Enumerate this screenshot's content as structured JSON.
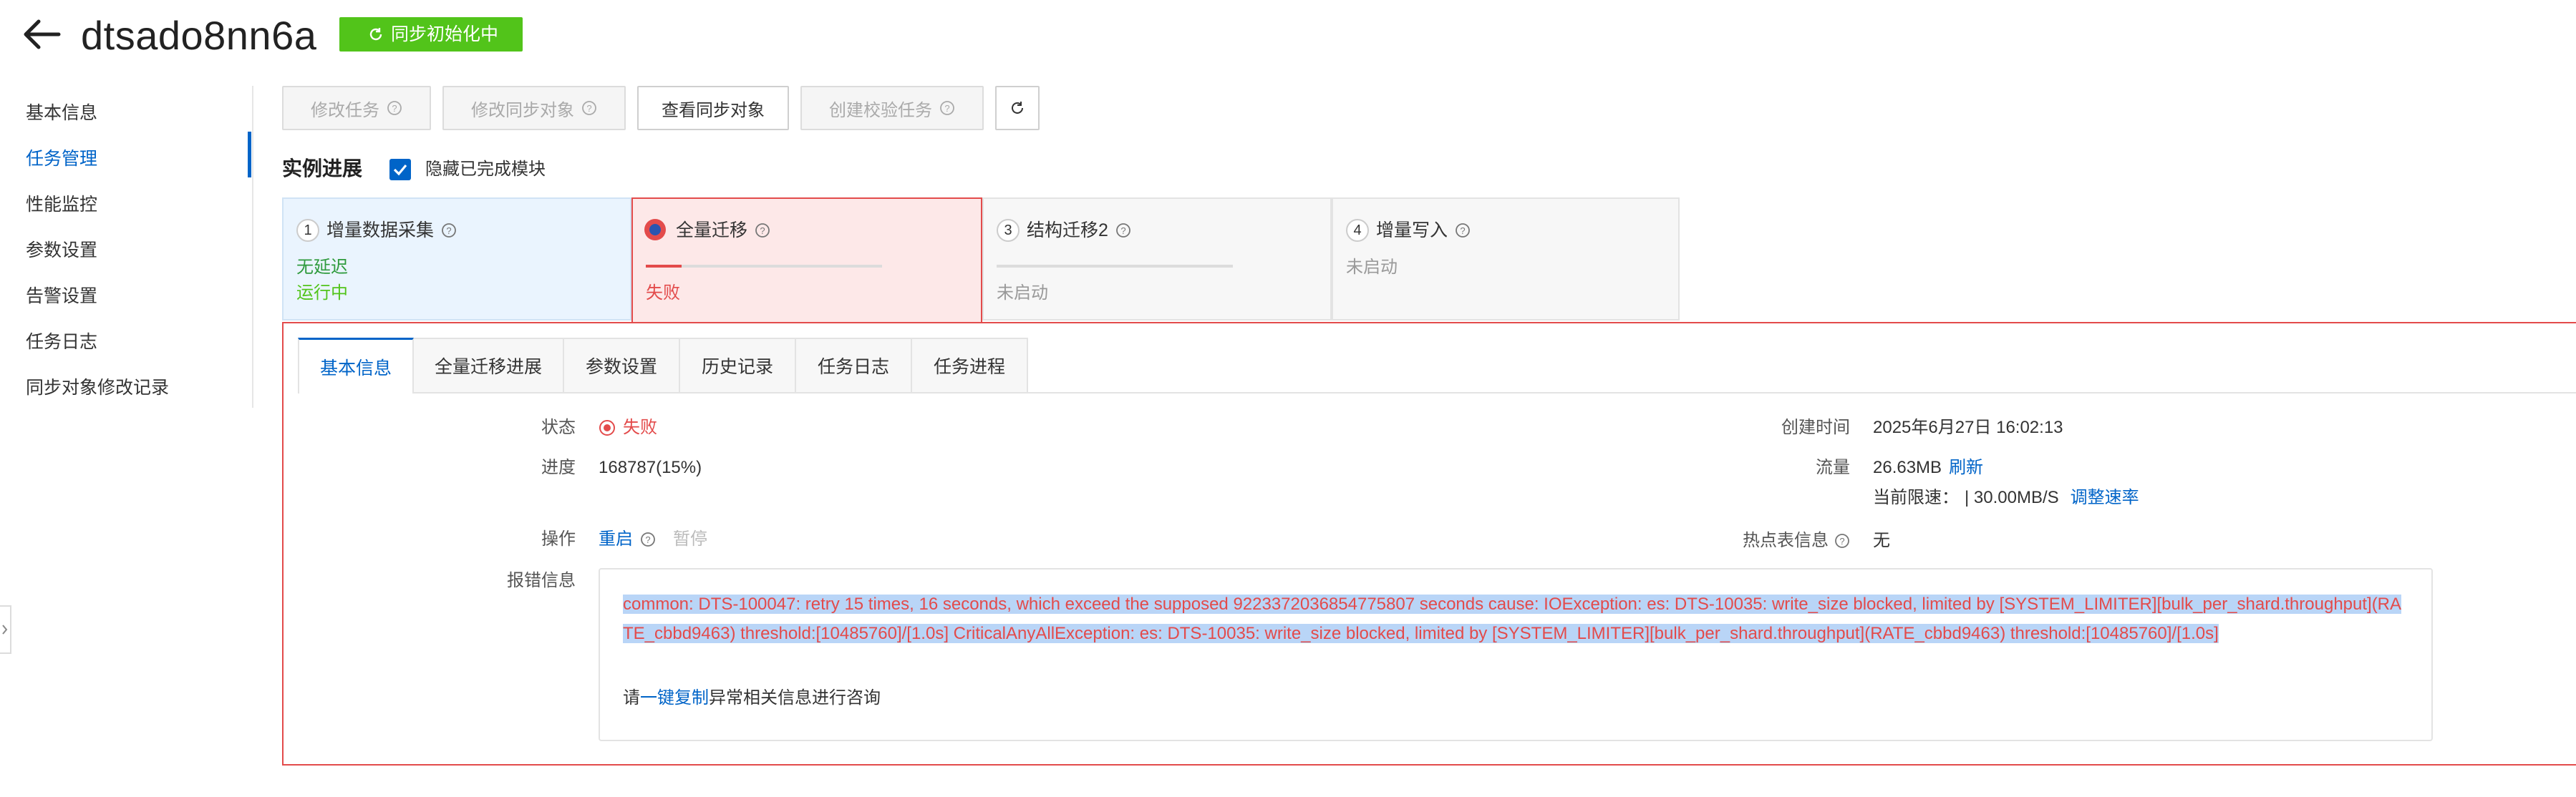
{
  "header": {
    "title": "dtsado8nn6a",
    "status_tag": "同步初始化中"
  },
  "sidebar": {
    "items": [
      {
        "label": "基本信息"
      },
      {
        "label": "任务管理"
      },
      {
        "label": "性能监控"
      },
      {
        "label": "参数设置"
      },
      {
        "label": "告警设置"
      },
      {
        "label": "任务日志"
      },
      {
        "label": "同步对象修改记录"
      }
    ],
    "active_index": 1
  },
  "toolbar": {
    "modify_task": "修改任务",
    "modify_sync_objects": "修改同步对象",
    "view_sync_objects": "查看同步对象",
    "create_check_task": "创建校验任务"
  },
  "progress": {
    "title": "实例进展",
    "hide_completed_label": "隐藏已完成模块",
    "hide_completed_checked": true,
    "steps": [
      {
        "num": "1",
        "name": "增量数据采集",
        "line1": "无延迟",
        "line2": "运行中"
      },
      {
        "num": "",
        "name": "全量迁移",
        "line1": "失败",
        "progress": 0.15
      },
      {
        "num": "3",
        "name": "结构迁移2",
        "line1": "未启动",
        "progress": 0
      },
      {
        "num": "4",
        "name": "增量写入",
        "line1": "未启动"
      }
    ]
  },
  "tabs": [
    "基本信息",
    "全量迁移进展",
    "参数设置",
    "历史记录",
    "任务日志",
    "任务进程"
  ],
  "detail": {
    "status_label": "状态",
    "status_value": "失败",
    "progress_label": "进度",
    "progress_value": "168787(15%)",
    "action_label": "操作",
    "action_restart": "重启",
    "action_pause": "暂停",
    "error_label": "报错信息",
    "created_label": "创建时间",
    "created_value": "2025年6月27日 16:02:13",
    "traffic_label": "流量",
    "traffic_value": "26.63MB",
    "refresh": "刷新",
    "rate_limit_label": "当前限速：",
    "rate_limit_value": "| 30.00MB/S",
    "adjust_rate": "调整速率",
    "hot_table_label": "热点表信息",
    "hot_table_value": "无",
    "error_text": "common: DTS-100047: retry 15 times, 16 seconds, which exceed the supposed 9223372036854775807 seconds cause: IOException: es: DTS-10035: write_size blocked, limited by [SYSTEM_LIMITER][bulk_per_shard.throughput](RATE_cbbd9463) threshold:[10485760]/[1.0s] CriticalAnyAllException: es: DTS-10035: write_size blocked, limited by [SYSTEM_LIMITER][bulk_per_shard.throughput](RATE_cbbd9463) threshold:[10485760]/[1.0s]",
    "help_prefix": "请",
    "help_link": "一键复制",
    "help_suffix": "异常相关信息进行咨询"
  },
  "colors": {
    "accent": "#0064c8",
    "success": "#52c41a",
    "error": "#e34b4b"
  }
}
